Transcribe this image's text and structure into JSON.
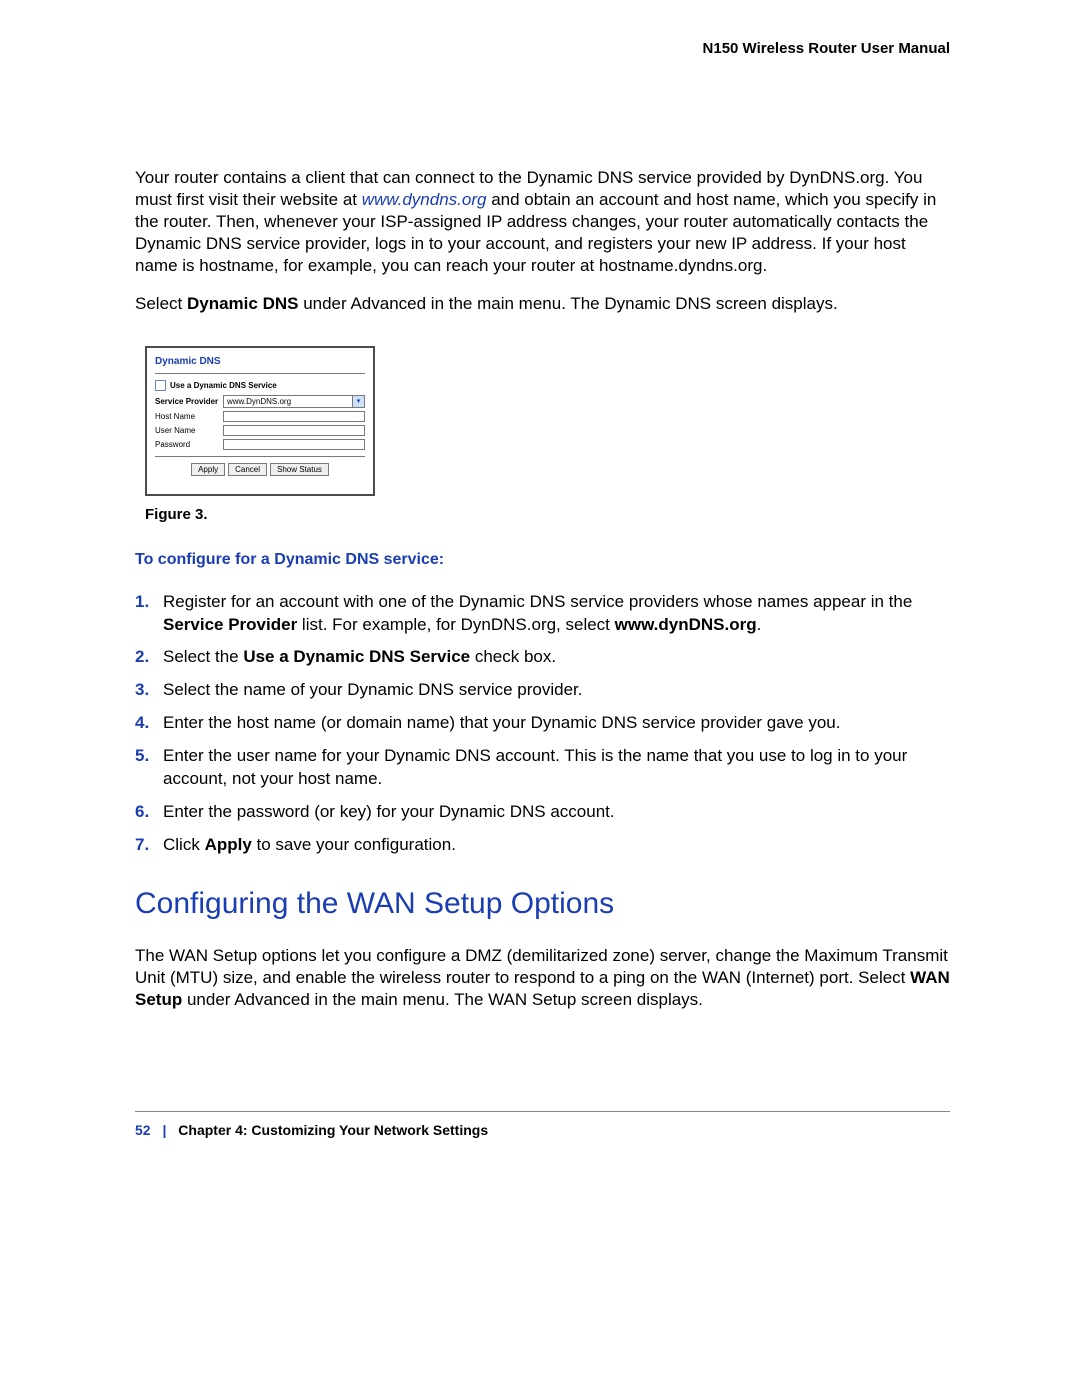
{
  "header": {
    "title": "N150 Wireless Router User Manual"
  },
  "intro": {
    "para1_a": "Your router contains a client that can connect to the Dynamic DNS service provided by DynDNS.org. You must first visit their website at ",
    "link": "www.dyndns.org",
    "para1_b": " and obtain an account and host name, which you specify in the router. Then, whenever your ISP-assigned IP address changes, your router automatically contacts the Dynamic DNS service provider, logs in to your account, and registers your new IP address. If your host name is hostname, for example, you can reach your router at hostname.dyndns.org.",
    "para2_a": "Select ",
    "para2_bold": "Dynamic DNS",
    "para2_b": " under Advanced in the main menu. The Dynamic DNS screen displays."
  },
  "panel": {
    "title": "Dynamic DNS",
    "checkbox_label": "Use a Dynamic DNS Service",
    "rows": {
      "provider_label": "Service Provider",
      "provider_value": "www.DynDNS.org",
      "host_label": "Host Name",
      "user_label": "User Name",
      "pass_label": "Password"
    },
    "buttons": {
      "apply": "Apply",
      "cancel": "Cancel",
      "status": "Show Status"
    }
  },
  "figure_caption": "Figure 3.  ",
  "procedure": {
    "heading": "To configure for a Dynamic DNS service:",
    "steps": {
      "s1_a": "Register for an account with one of the Dynamic DNS service providers whose names appear in the ",
      "s1_b1": "Service Provider",
      "s1_c": " list. For example, for DynDNS.org, select ",
      "s1_b2": "www.dynDNS.org",
      "s1_d": ".",
      "s2_a": "Select the ",
      "s2_b": "Use a Dynamic DNS Service",
      "s2_c": " check box.",
      "s3": "Select the name of your Dynamic DNS service provider.",
      "s4": "Enter the host name (or domain name) that your Dynamic DNS service provider gave you.",
      "s5": "Enter the user name for your Dynamic DNS account. This is the name that you use to log in to your account, not your host name.",
      "s6": "Enter the password (or key) for your Dynamic DNS account.",
      "s7_a": "Click ",
      "s7_b": "Apply",
      "s7_c": " to save your configuration."
    }
  },
  "section": {
    "heading": "Configuring the WAN Setup Options",
    "para_a": "The WAN Setup options let you configure a DMZ (demilitarized zone) server, change the Maximum Transmit Unit (MTU) size, and enable the wireless router to respond to a ping on the WAN (Internet) port. Select ",
    "para_bold": "WAN Setup",
    "para_b": " under Advanced in the main menu. The WAN Setup screen displays."
  },
  "footer": {
    "page": "52",
    "sep": "|",
    "chapter": "Chapter 4:  Customizing Your Network Settings"
  }
}
